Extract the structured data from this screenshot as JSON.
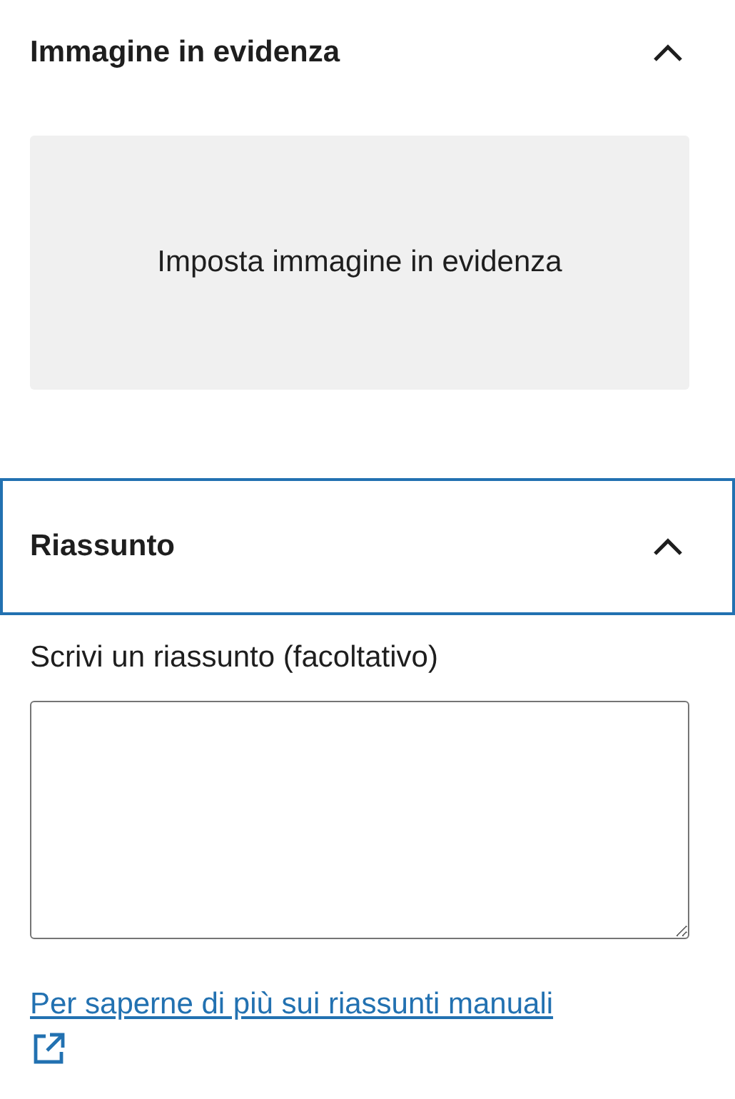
{
  "panels": [
    {
      "kind": "featured-image",
      "title": "Immagine in evidenza",
      "expanded": true,
      "focused": false,
      "button": "Imposta immagine in evidenza"
    },
    {
      "kind": "excerpt",
      "title": "Riassunto",
      "expanded": true,
      "focused": true,
      "label": "Scrivi un riassunto (facoltativo)",
      "link": "Per saperne di più sui riassunti manuali"
    }
  ]
}
